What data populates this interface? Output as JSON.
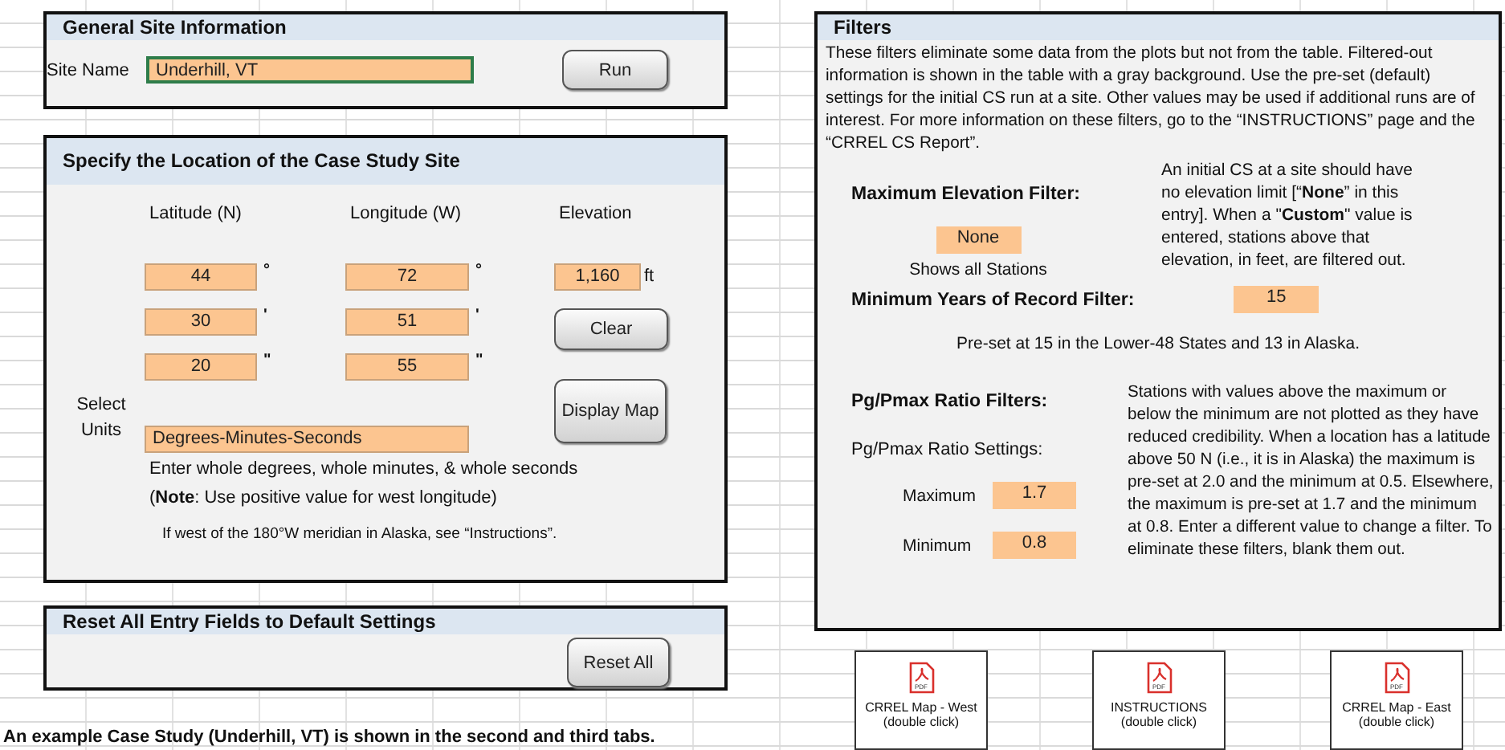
{
  "general": {
    "title": "General Site Information",
    "site_label": "Site Name",
    "site_name": "Underhill, VT",
    "run_button": "Run"
  },
  "location": {
    "title": "Specify the Location of the Case Study Site",
    "columns": [
      "Latitude (N)",
      "Longitude (W)",
      "Elevation"
    ],
    "rows": [
      {
        "lat": "44",
        "lon": "72",
        "mark": "°"
      },
      {
        "lat": "30",
        "lon": "51",
        "mark": "'"
      },
      {
        "lat": "20",
        "lon": "55",
        "mark": "\""
      }
    ],
    "elevation": "1,160",
    "elevation_unit": "ft",
    "clear_button": "Clear",
    "map_button": "Display Map",
    "units_label": "Select Units",
    "units": "Degrees-Minutes-Seconds",
    "instructions": "Enter whole degrees, whole minutes, & whole seconds",
    "note": "(**Note**: Use positive value for west longitude)",
    "alaska_note": "If west of the 180°W meridian in Alaska, see “Instructions”."
  },
  "reset": {
    "title": "Reset All Entry Fields to Default Settings",
    "button": "Reset All"
  },
  "footer": "An example Case Study (Underhill, VT) is shown in the second and third tabs.",
  "filters": {
    "title": "Filters",
    "intro": "These filters eliminate some data from the plots but not from the table. Filtered-out information is shown in the table with a gray background. Use the pre-set (default) settings for the initial CS run at a site. Other values may be used if additional runs are of interest. For more information on these filters, go to the “INSTRUCTIONS” page and the “CRREL CS Report”.",
    "max_elev_label": "Maximum Elevation Filter:",
    "max_elev_value": "None",
    "max_elev_hint": "Shows all Stations",
    "max_elev_help": "An initial CS at a site should have no elevation limit [“**None**” in this entry]. When a \"**Custom**\" value is entered, stations above that elevation, in feet, are filtered out.",
    "min_years_label": "Minimum Years of Record Filter:",
    "min_years_value": "15",
    "min_years_note": "Pre-set at 15 in the Lower-48 States and 13 in Alaska.",
    "ratio_title": "Pg/Pmax Ratio Filters:",
    "ratio_settings_label": "Pg/Pmax Ratio Settings:",
    "ratio_max_label": "Maximum",
    "ratio_max": "1.7",
    "ratio_min_label": "Minimum",
    "ratio_min": "0.8",
    "ratio_help": "Stations with values above the maximum or below the minimum are not plotted as they have reduced credibility. When a location has a latitude above 50 N (i.e., it is in Alaska) the maximum is pre-set at 2.0 and the minimum at 0.5. Elsewhere, the maximum is pre-set at 1.7 and the minimum at 0.8. Enter a different value to change a filter. To eliminate these filters, blank them out."
  },
  "attachments": [
    {
      "icon_label": "PDF",
      "name": "CRREL Map - West",
      "hint": "(double click)"
    },
    {
      "icon_label": "PDF",
      "name": "INSTRUCTIONS",
      "hint": "(double click)"
    },
    {
      "icon_label": "PDF",
      "name": "CRREL Map - East",
      "hint": "(double click)"
    }
  ]
}
